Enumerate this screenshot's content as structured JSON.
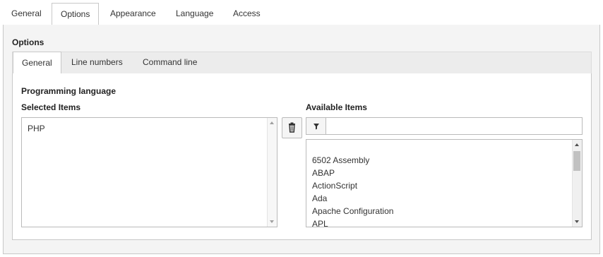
{
  "outer_tabs": [
    {
      "label": "General",
      "active": false
    },
    {
      "label": "Options",
      "active": true
    },
    {
      "label": "Appearance",
      "active": false
    },
    {
      "label": "Language",
      "active": false
    },
    {
      "label": "Access",
      "active": false
    }
  ],
  "options": {
    "title": "Options",
    "inner_tabs": [
      {
        "label": "General",
        "active": true
      },
      {
        "label": "Line numbers",
        "active": false
      },
      {
        "label": "Command line",
        "active": false
      }
    ],
    "field_label": "Programming language",
    "selected": {
      "label": "Selected Items",
      "items": [
        "PHP"
      ]
    },
    "delete_icon": "trash-icon",
    "available": {
      "label": "Available Items",
      "filter_icon": "filter-icon",
      "filter_value": "",
      "items": [
        "6502 Assembly",
        "ABAP",
        "ActionScript",
        "Ada",
        "Apache Configuration",
        "APL"
      ]
    }
  }
}
